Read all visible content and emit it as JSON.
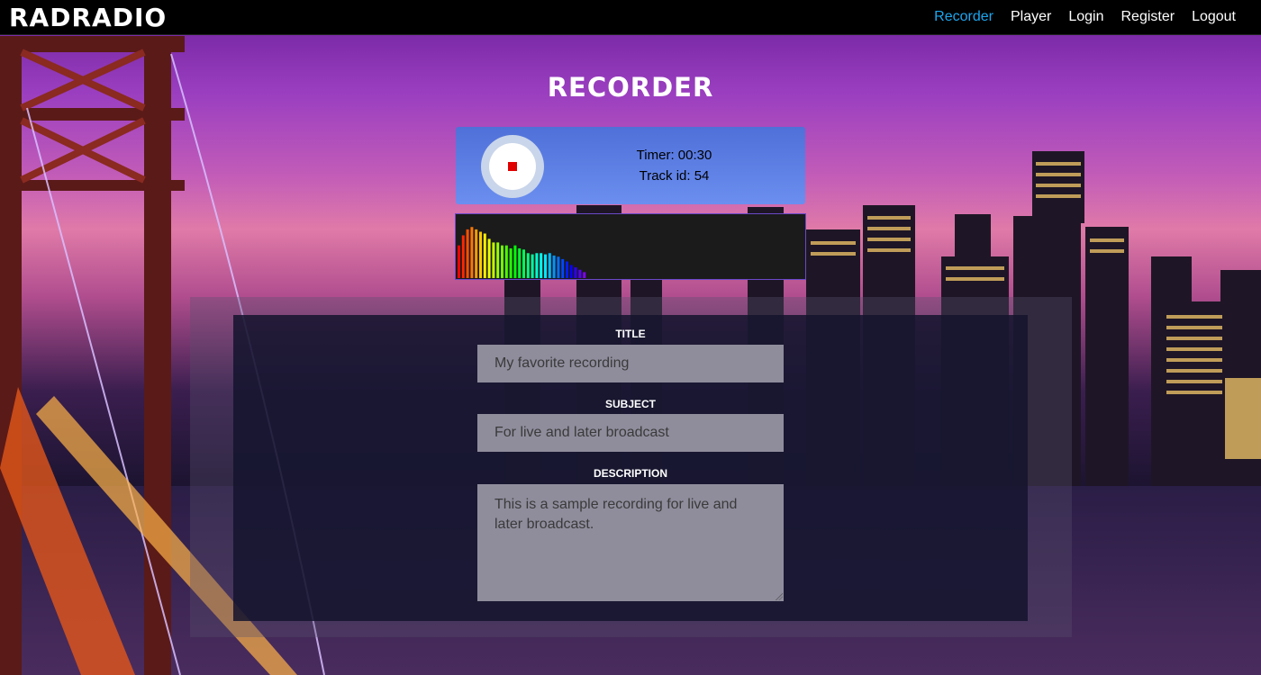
{
  "brand": "RADRADIO",
  "nav": {
    "recorder": "Recorder",
    "player": "Player",
    "login": "Login",
    "register": "Register",
    "logout": "Logout"
  },
  "page_title": "RECORDER",
  "recorder": {
    "timer_text": "Timer: 00:30",
    "track_text": "Track id: 54",
    "button_icon": "stop-icon"
  },
  "visualizer": {
    "levels": [
      0.55,
      0.72,
      0.82,
      0.86,
      0.82,
      0.78,
      0.75,
      0.66,
      0.6,
      0.6,
      0.55,
      0.55,
      0.5,
      0.55,
      0.5,
      0.48,
      0.42,
      0.4,
      0.42,
      0.42,
      0.4,
      0.42,
      0.38,
      0.36,
      0.32,
      0.28,
      0.22,
      0.18,
      0.14,
      0.1
    ]
  },
  "form": {
    "title_label": "TITLE",
    "title_value": "My favorite recording",
    "subject_label": "SUBJECT",
    "subject_value": "For live and later broadcast",
    "description_label": "DESCRIPTION",
    "description_value": "This is a sample recording for live and later broadcast."
  },
  "colors": {
    "accent": "#1ba7f0",
    "navbar": "#000000",
    "recorder_panel": "#5b7de2",
    "stop": "#e00000"
  }
}
